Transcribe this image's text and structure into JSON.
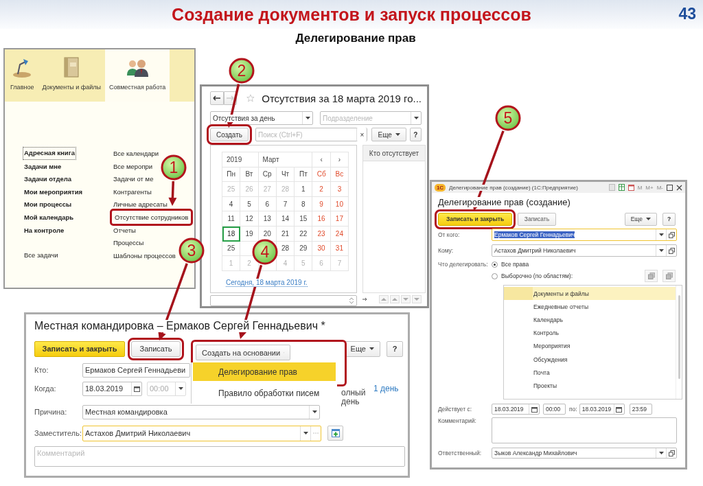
{
  "slide": {
    "title": "Создание документов и запуск процессов",
    "number": "43",
    "subtitle": "Делегирование прав"
  },
  "sections_panel": {
    "tabs": [
      {
        "label": "Главное",
        "selected": false
      },
      {
        "label": "Документы и файлы",
        "selected": false
      },
      {
        "label": "Совместная работа",
        "selected": true
      }
    ],
    "left_groups": [
      [
        {
          "text": "Адресная книга",
          "bold": true,
          "focused": true
        },
        {
          "text": "Задачи мне",
          "bold": true,
          "focused": false
        },
        {
          "text": "Задачи отдела",
          "bold": true,
          "focused": false
        },
        {
          "text": "Мои мероприятия",
          "bold": true,
          "focused": false
        },
        {
          "text": "Мои процессы",
          "bold": true,
          "focused": false
        },
        {
          "text": "Мой календарь",
          "bold": true,
          "focused": false
        },
        {
          "text": "На контроле",
          "bold": true,
          "focused": false
        }
      ],
      [
        {
          "text": "Все задачи",
          "bold": false,
          "focused": false
        }
      ]
    ],
    "right_links": [
      {
        "text": "Все календари",
        "highlighted": false
      },
      {
        "text": "Все меропри",
        "highlighted": false
      },
      {
        "text": "Задачи от ме",
        "highlighted": false
      },
      {
        "text": "Контрагенты",
        "highlighted": false
      },
      {
        "text": "Личные адресаты",
        "highlighted": false
      },
      {
        "text": "Отсутствие сотрудников",
        "highlighted": true
      },
      {
        "text": "Отчеты",
        "highlighted": false
      },
      {
        "text": "Процессы",
        "highlighted": false
      },
      {
        "text": "Шаблоны процессов",
        "highlighted": false
      }
    ]
  },
  "absence_window": {
    "title": "Отсутствия за 18 марта 2019 го...",
    "period": "Отсутствия за день",
    "department_placeholder": "Подразделение",
    "create_button": "Создать",
    "create_highlighted": true,
    "search_placeholder": "Поиск (Ctrl+F)",
    "clear_button": "×",
    "more_button": "Еще",
    "help_button": "?",
    "year": "2019",
    "month": "Март",
    "prev_button": "‹",
    "next_button": "›",
    "weekdays": [
      {
        "text": "Пн",
        "weekend": false
      },
      {
        "text": "Вт",
        "weekend": false
      },
      {
        "text": "Ср",
        "weekend": false
      },
      {
        "text": "Чт",
        "weekend": false
      },
      {
        "text": "Пт",
        "weekend": false
      },
      {
        "text": "Сб",
        "weekend": true
      },
      {
        "text": "Вс",
        "weekend": true
      }
    ],
    "weeks": [
      [
        {
          "day": "25",
          "kind": "other",
          "selected": false
        },
        {
          "day": "26",
          "kind": "other",
          "selected": false
        },
        {
          "day": "27",
          "kind": "other",
          "selected": false
        },
        {
          "day": "28",
          "kind": "other",
          "selected": false
        },
        {
          "day": "1",
          "kind": "work",
          "selected": false
        },
        {
          "day": "2",
          "kind": "weekend",
          "selected": false
        },
        {
          "day": "3",
          "kind": "weekend",
          "selected": false
        }
      ],
      [
        {
          "day": "4",
          "kind": "work",
          "selected": false
        },
        {
          "day": "5",
          "kind": "work",
          "selected": false
        },
        {
          "day": "6",
          "kind": "work",
          "selected": false
        },
        {
          "day": "7",
          "kind": "work",
          "selected": false
        },
        {
          "day": "8",
          "kind": "work",
          "selected": false
        },
        {
          "day": "9",
          "kind": "weekend",
          "selected": false
        },
        {
          "day": "10",
          "kind": "weekend",
          "selected": false
        }
      ],
      [
        {
          "day": "11",
          "kind": "work",
          "selected": false
        },
        {
          "day": "12",
          "kind": "work",
          "selected": false
        },
        {
          "day": "13",
          "kind": "work",
          "selected": false
        },
        {
          "day": "14",
          "kind": "work",
          "selected": false
        },
        {
          "day": "15",
          "kind": "work",
          "selected": false
        },
        {
          "day": "16",
          "kind": "weekend",
          "selected": false
        },
        {
          "day": "17",
          "kind": "weekend",
          "selected": false
        }
      ],
      [
        {
          "day": "18",
          "kind": "work",
          "selected": true
        },
        {
          "day": "19",
          "kind": "work",
          "selected": false
        },
        {
          "day": "20",
          "kind": "work",
          "selected": false
        },
        {
          "day": "21",
          "kind": "work",
          "selected": false
        },
        {
          "day": "22",
          "kind": "work",
          "selected": false
        },
        {
          "day": "23",
          "kind": "weekend",
          "selected": false
        },
        {
          "day": "24",
          "kind": "weekend",
          "selected": false
        }
      ],
      [
        {
          "day": "25",
          "kind": "work",
          "selected": false
        },
        {
          "kind": "hidden"
        },
        {
          "kind": "hidden"
        },
        {
          "day": "28",
          "kind": "work",
          "selected": false
        },
        {
          "day": "29",
          "kind": "work",
          "selected": false
        },
        {
          "day": "30",
          "kind": "weekend",
          "selected": false
        },
        {
          "day": "31",
          "kind": "weekend",
          "selected": false
        }
      ],
      [
        {
          "day": "1",
          "kind": "other",
          "selected": false
        },
        {
          "day": "2",
          "kind": "other",
          "selected": false
        },
        {
          "kind": "hidden"
        },
        {
          "day": "4",
          "kind": "other",
          "selected": false
        },
        {
          "day": "5",
          "kind": "other",
          "selected": false
        },
        {
          "day": "6",
          "kind": "other",
          "selected": false
        },
        {
          "day": "7",
          "kind": "other",
          "selected": false
        }
      ]
    ],
    "today_link": "Сегодня, 18 марта 2019 г.",
    "absent_column": "Кто отсутствует"
  },
  "trip_window": {
    "title": "Местная командировка – Ермаков Сергей Геннадьевич *",
    "buttons": [
      {
        "label": "Записать и закрыть",
        "kind": "primary",
        "highlighted": false
      },
      {
        "label": "Записать",
        "kind": "normal",
        "highlighted": true
      }
    ],
    "create_based_button": "Создать на основании",
    "more_button": "Еще",
    "help_button": "?",
    "menu": [
      {
        "label": "Делегирование прав",
        "selected": true
      },
      {
        "label": "Правило обработки писем",
        "selected": false
      }
    ],
    "who_label": "Кто:",
    "who_value": "Ермаков Сергей Геннадьеви",
    "when_label": "Когда:",
    "when_date": "18.03.2019",
    "when_time": "00:00",
    "when_time_disabled": true,
    "partial_text": "олный день",
    "duration_link": "1 день",
    "reason_label": "Причина:",
    "reason_value": "Местная командировка",
    "deputy_label": "Заместитель:",
    "deputy_value": "Астахов Дмитрий Николаевич",
    "comment_placeholder": "Комментарий"
  },
  "delegation_window": {
    "logo": "1С",
    "caption": "Делегирование прав (создание) (1С:Предприятие)",
    "title_tools": [
      "M",
      "M+",
      "M-"
    ],
    "heading": "Делегирование прав (создание)",
    "buttons": [
      {
        "label": "Записать и закрыть",
        "kind": "primary",
        "highlighted": true
      },
      {
        "label": "Записать",
        "kind": "normal",
        "highlighted": false
      }
    ],
    "more_button": "Еще",
    "help_button": "?",
    "from_label": "От кого:",
    "from_value": "Ермаков Сергей Геннадьевич",
    "from_value_selected": true,
    "to_label": "Кому:",
    "to_value": "Астахов Дмитрий Николаевич",
    "scope_label": "Что делегировать:",
    "scope_options": [
      {
        "label": "Все права",
        "selected": true
      },
      {
        "label": "Выборочно (по областям):",
        "selected": false
      }
    ],
    "areas": [
      {
        "text": "Документы и файлы",
        "selected": true
      },
      {
        "text": "Ежедневные отчеты",
        "selected": false
      },
      {
        "text": "Календарь",
        "selected": false
      },
      {
        "text": "Контроль",
        "selected": false
      },
      {
        "text": "Мероприятия",
        "selected": false
      },
      {
        "text": "Обсуждения",
        "selected": false
      },
      {
        "text": "Почта",
        "selected": false
      },
      {
        "text": "Проекты",
        "selected": false
      }
    ],
    "valid_label": "Действует с:",
    "from_date": "18.03.2019",
    "from_time": "00:00",
    "to_word": "по:",
    "to_date": "18.03.2019",
    "to_time": "23:59",
    "comment_label": "Комментарий:",
    "responsible_label": "Ответственный:",
    "responsible_value": "Зыков Александр Михайлович"
  },
  "callouts": [
    {
      "label": "1"
    },
    {
      "label": "2"
    },
    {
      "label": "3"
    },
    {
      "label": "4"
    },
    {
      "label": "5"
    }
  ]
}
